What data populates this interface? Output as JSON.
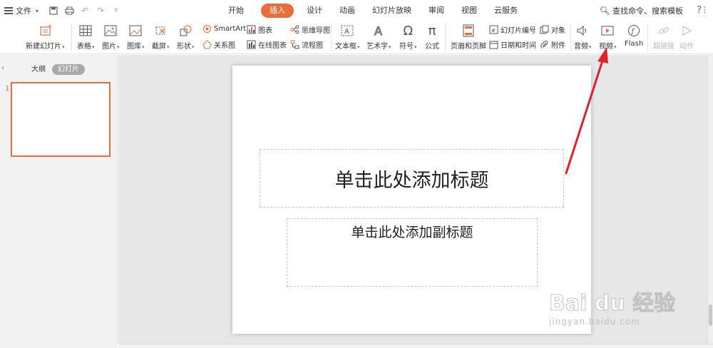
{
  "menu": {
    "file_label": "文件",
    "tabs": [
      "开始",
      "插入",
      "设计",
      "动画",
      "幻灯片放映",
      "审阅",
      "视图",
      "云服务"
    ],
    "active_tab": "插入",
    "search_text": "查找命令、搜索模板",
    "help": "?"
  },
  "ribbon": {
    "new_slide": "新建幻灯片",
    "table": "表格",
    "picture": "图片",
    "gallery": "图库",
    "screenshot": "截屏",
    "shape": "形状",
    "smartart": "SmartArt",
    "chart": "图表",
    "relation": "关系图",
    "online_chart": "在线图表",
    "mindmap": "思维导图",
    "flowchart": "流程图",
    "textbox": "文本框",
    "wordart": "艺术字",
    "symbol": "符号",
    "formula": "公式",
    "header_footer": "页眉和页脚",
    "slide_number": "幻灯片编号",
    "object": "对象",
    "date_time": "日期和时间",
    "attachment": "附件",
    "audio": "音频",
    "video": "视频",
    "flash": "Flash",
    "hyperlink": "超链接",
    "action": "动作"
  },
  "panel": {
    "outline_tab": "大纲",
    "slides_tab": "幻灯片",
    "slide_number": "1"
  },
  "slide": {
    "title_placeholder": "单击此处添加标题",
    "subtitle_placeholder": "单击此处添加副标题"
  },
  "watermark": {
    "brand": "Bai du 经验",
    "url": "jingyan.baidu.com"
  },
  "colors": {
    "accent": "#e96f3a",
    "annotation_arrow": "#e0202a"
  }
}
